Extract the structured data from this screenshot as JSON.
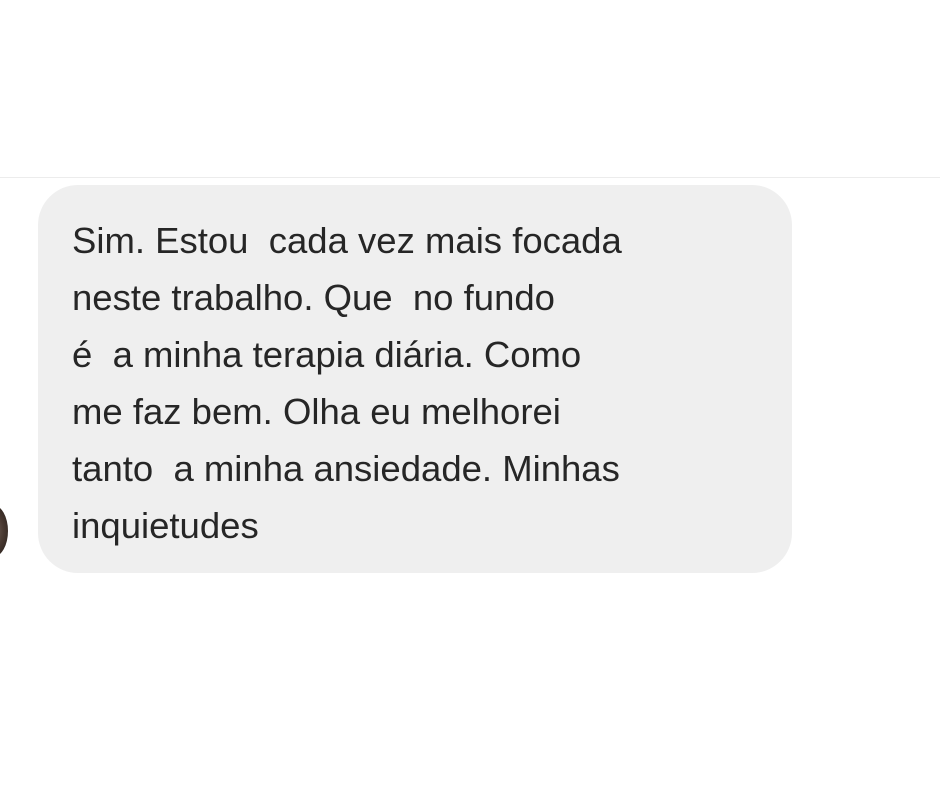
{
  "conversation": {
    "message": {
      "lines": [
        "Sim. Estou  cada vez mais focada",
        "neste trabalho. Que  no fundo",
        "é  a minha terapia diária. Como",
        "me faz bem. Olha eu melhorei",
        "tanto  a minha ansiedade. Minhas",
        "inquietudes"
      ],
      "bubble_color": "#efefef",
      "text_color": "#262626"
    },
    "sender": {
      "avatar_icon": "profile-avatar"
    }
  }
}
